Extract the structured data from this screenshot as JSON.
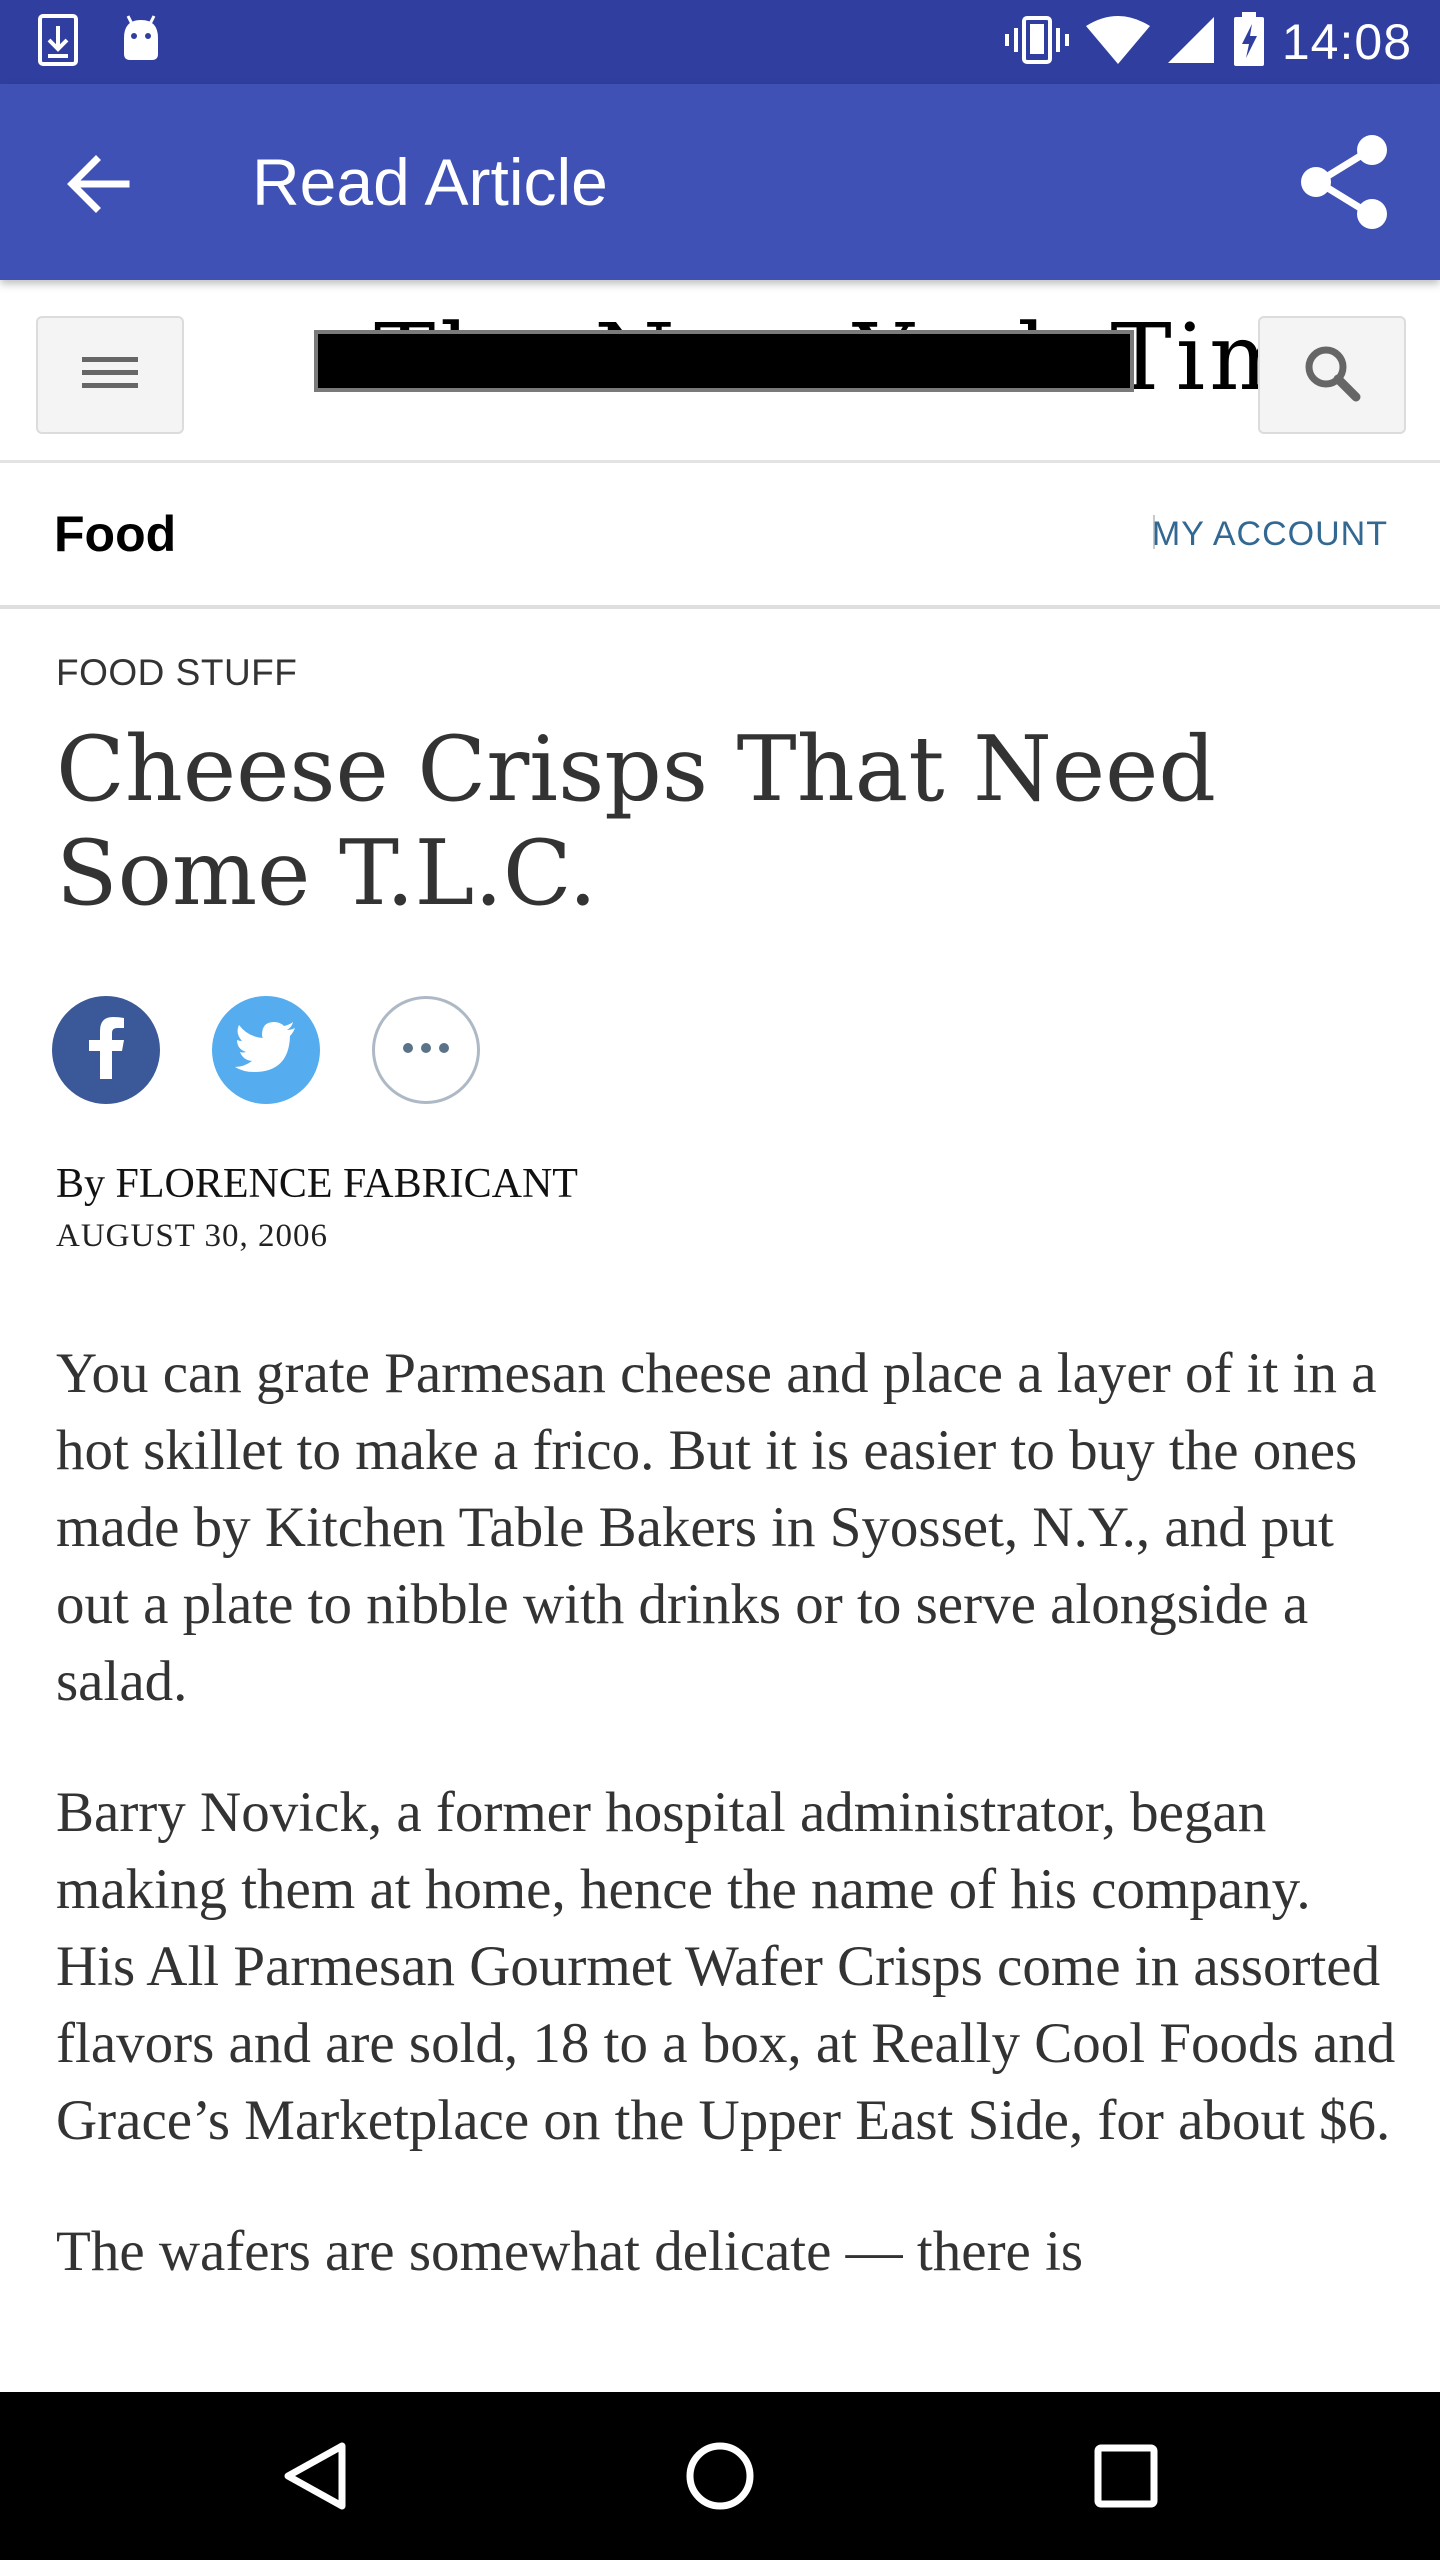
{
  "status_bar": {
    "time": "14:08",
    "left_icons": [
      "download-icon",
      "android-icon"
    ],
    "right_icons": [
      "vibrate-icon",
      "wifi-icon",
      "signal-icon",
      "battery-charging-icon"
    ]
  },
  "app_bar": {
    "title": "Read Article",
    "color": "#3f51b5"
  },
  "masthead": {
    "logo_text": "The New York Times"
  },
  "section_bar": {
    "section": "Food",
    "account_link": "MY ACCOUNT"
  },
  "article": {
    "kicker": "FOOD STUFF",
    "headline_line1": "Cheese Crisps That Need",
    "headline_line2": "Some T.L.C.",
    "byline": "By FLORENCE FABRICANT",
    "date": "AUGUST 30, 2006",
    "paragraphs": [
      "You can grate Parmesan cheese and place a layer of it in a hot skillet to make a frico. But it is easier to buy the ones made by Kitchen Table Bakers in Syosset, N.Y., and put out a plate to nibble with drinks or to serve alongside a salad.",
      "Barry Novick, a former hospital administrator, began making them at home, hence the name of his company. His All Parmesan Gourmet Wafer Crisps come in assorted flavors and are sold, 18 to a box, at Really Cool Foods and Grace’s Marketplace on the Upper East Side, for about $6.",
      "The wafers are somewhat delicate — there is"
    ]
  },
  "share": {
    "facebook_color": "#3b5998",
    "twitter_color": "#55acee",
    "more_glyph": "•••"
  }
}
